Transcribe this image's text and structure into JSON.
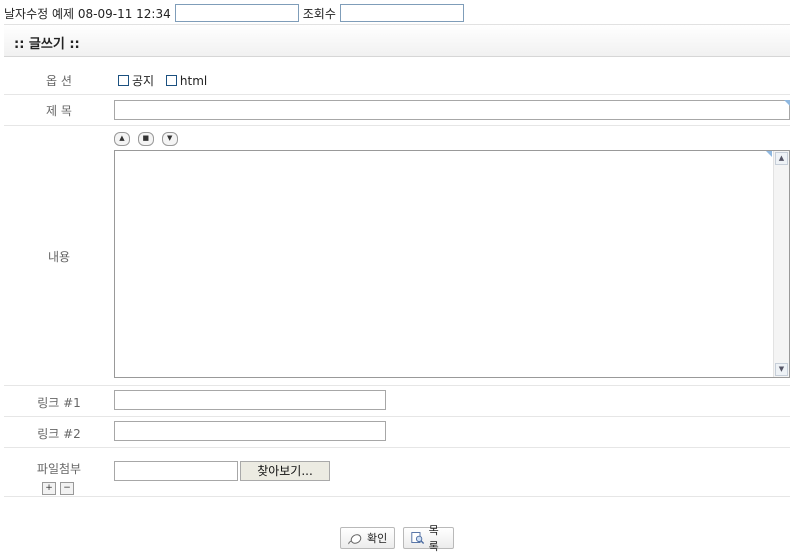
{
  "top": {
    "date_label": "날자수정 예제 08-09-11 12:34",
    "date_value": "",
    "views_label": "조회수",
    "views_value": ""
  },
  "title": ":: 글쓰기 ::",
  "form": {
    "options": {
      "label": "옵 션",
      "notice": "공지",
      "html": "html"
    },
    "subject": {
      "label": "제 목",
      "value": ""
    },
    "content": {
      "label": "내용",
      "up": "▲",
      "reset": "■",
      "down": "▼",
      "value": ""
    },
    "link1": {
      "label": "링크 #1",
      "value": ""
    },
    "link2": {
      "label": "링크 #2",
      "value": ""
    },
    "file": {
      "label": "파일첨부",
      "browse": "찾아보기...",
      "plus": "+",
      "minus": "−"
    }
  },
  "actions": {
    "confirm": "확인",
    "list": "목록"
  },
  "icons": {
    "confirm": "mouse-icon",
    "list": "list-search-icon"
  }
}
